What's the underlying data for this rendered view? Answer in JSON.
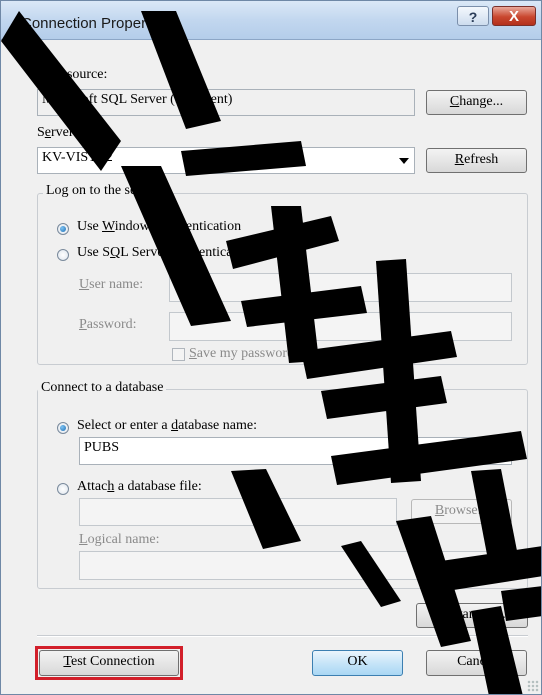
{
  "window": {
    "title": "Connection Properties",
    "help_button": "?",
    "close_button": "X"
  },
  "data_source": {
    "label_pre": "Data ",
    "label_ul": "s",
    "label_post": "ource:",
    "value": "Microsoft SQL Server (SqlClient)",
    "change_pre": "",
    "change_ul": "C",
    "change_post": "hange..."
  },
  "server": {
    "label_pre": "S",
    "label_ul": "e",
    "label_post": "rver name:",
    "value": "KV-VISTA2",
    "refresh_pre": "",
    "refresh_ul": "R",
    "refresh_post": "efresh"
  },
  "logon": {
    "legend": "Log on to the server",
    "windows_auth_pre": "Use ",
    "windows_auth_ul": "W",
    "windows_auth_post": "indows Authentication",
    "sql_auth_pre": "Use S",
    "sql_auth_ul": "Q",
    "sql_auth_post": "L Server Authentication",
    "username_ul": "U",
    "username_post": "ser name:",
    "username_value": "",
    "password_ul": "P",
    "password_post": "assword:",
    "password_value": "",
    "save_pw_ul": "S",
    "save_pw_post": "ave my password"
  },
  "database": {
    "legend": "Connect to a database",
    "select_pre": "Select or enter a ",
    "select_ul": "d",
    "select_post": "atabase name:",
    "db_value": "PUBS",
    "attach_pre": "Attac",
    "attach_ul": "h",
    "attach_post": " a database file:",
    "file_value": "",
    "browse_ul": "B",
    "browse_post": "rowse...",
    "logical_ul": "L",
    "logical_post": "ogical name:",
    "logical_value": ""
  },
  "buttons": {
    "advanced_pre": "Ad",
    "advanced_ul": "v",
    "advanced_post": "anced...",
    "test_ul": "T",
    "test_post": "est Connection",
    "ok": "OK",
    "cancel": "Cancel"
  },
  "state": {
    "windows_auth_selected": true,
    "select_db_selected": true,
    "save_password_checked": false
  },
  "colors": {
    "highlight_box": "#d21f2a",
    "watermark": "#000000"
  }
}
